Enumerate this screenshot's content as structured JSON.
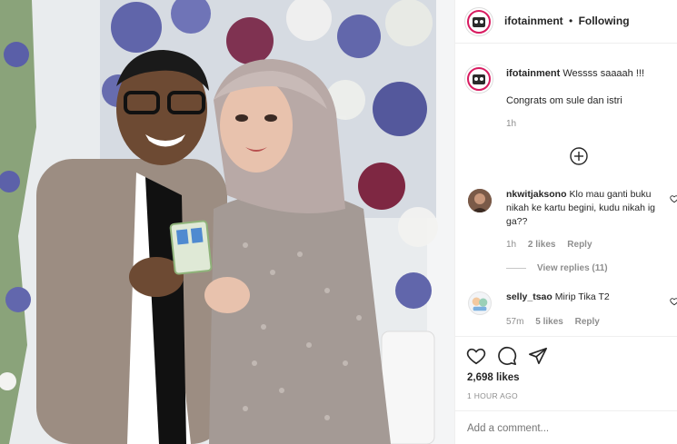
{
  "post": {
    "author": "ifotainment",
    "separator": "•",
    "follow_status": "Following"
  },
  "caption": {
    "author": "ifotainment",
    "text_line1": "Wessss saaaah !!!",
    "text_line2": "Congrats om sule dan istri",
    "time": "1h"
  },
  "comments": [
    {
      "username": "nkwitjaksono",
      "text": "Klo mau ganti buku nikah ke kartu begini, kudu nikah ig ga??",
      "time": "1h",
      "likes": "2 likes",
      "reply": "Reply",
      "view_replies": "View replies (11)"
    },
    {
      "username": "selly_tsao",
      "text": "Mirip Tika T2",
      "time": "57m",
      "likes": "5 likes",
      "reply": "Reply"
    }
  ],
  "footer": {
    "like_count": "2,698 likes",
    "posted_ago": "1 HOUR AGO",
    "add_comment_placeholder": "Add a comment..."
  },
  "icons": {
    "load_more": "plus-circle-icon",
    "like": "heart-icon",
    "comment": "comment-bubble-icon",
    "share": "paper-plane-icon"
  }
}
